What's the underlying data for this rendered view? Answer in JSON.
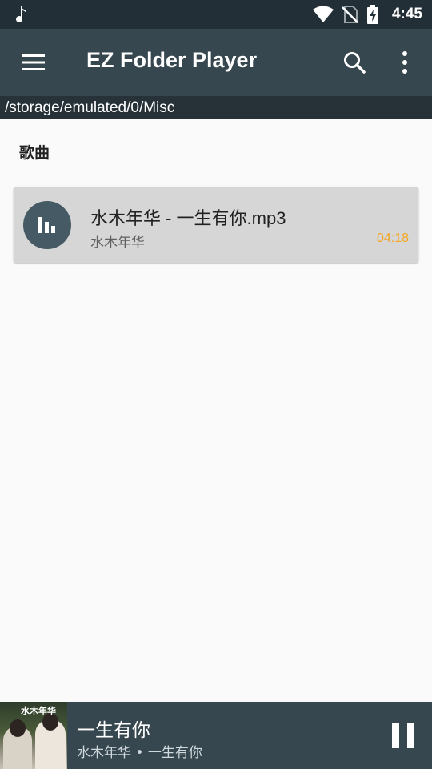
{
  "status_bar": {
    "time": "4:45",
    "icons": [
      "music-note-icon",
      "wifi-icon",
      "no-sim-icon",
      "battery-charging-icon"
    ]
  },
  "toolbar": {
    "title": "EZ Folder Player",
    "icons": [
      "menu-icon",
      "search-icon",
      "more-vert-icon"
    ]
  },
  "path": "/storage/emulated/0/Misc",
  "section_title": "歌曲",
  "songs": [
    {
      "name": "水木年华 - 一生有你.mp3",
      "artist": "水木年华",
      "duration": "04:18",
      "icon": "equalizer-icon"
    }
  ],
  "now_playing": {
    "cover_text": "水木年华",
    "title": "一生有你",
    "subtitle": "水木年华 • 一生有你",
    "control_icon": "pause-icon"
  },
  "colors": {
    "status_bar": "#232f37",
    "toolbar": "#37474f",
    "path_bar": "#263238",
    "accent": "#f5a623",
    "card": "#d6d6d6"
  }
}
